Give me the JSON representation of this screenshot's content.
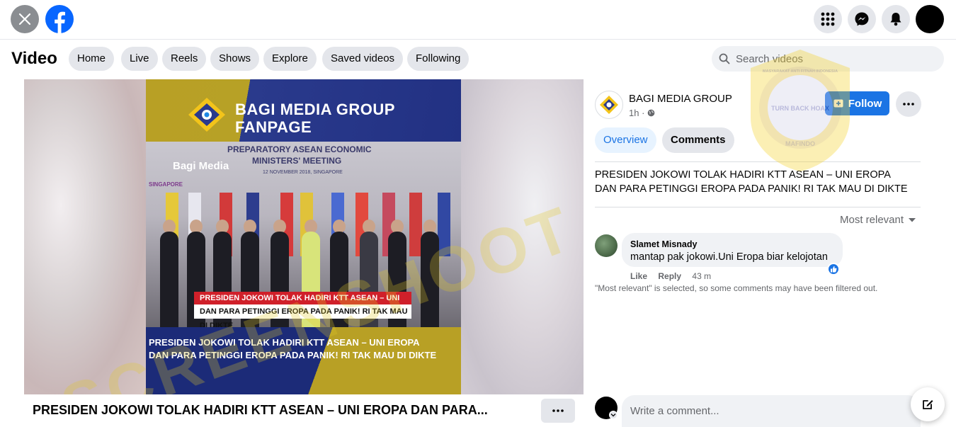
{
  "topbar": {
    "close_icon": "close-icon",
    "logo_icon": "facebook-logo-icon",
    "menu_icon": "grid-menu-icon",
    "messenger_icon": "messenger-icon",
    "notifications_icon": "bell-icon"
  },
  "nav": {
    "title": "Video",
    "tabs": [
      {
        "label": "Home"
      },
      {
        "label": "Live"
      },
      {
        "label": "Reels"
      },
      {
        "label": "Shows"
      },
      {
        "label": "Explore"
      },
      {
        "label": "Saved videos"
      },
      {
        "label": "Following"
      }
    ],
    "search_placeholder": "Search videos"
  },
  "video": {
    "brand_line1": "BAGI MEDIA GROUP",
    "brand_line2": "FANPAGE",
    "banner_line1": "PREPARATORY ASEAN ECONOMIC",
    "banner_line2": "MINISTERS' MEETING",
    "banner_date": "12 NOVEMBER 2018, SINGAPORE",
    "bagi_small": "Bagi Media",
    "singapore": "SINGAPORE",
    "red_band": "PRESIDEN JOKOWI TOLAK HADIRI KTT ASEAN – UNI EROPA",
    "white_band": "DAN PARA PETINGGI EROPA PADA PANIK! RI TAK MAU DI DIKTE",
    "caption_line1": "PRESIDEN JOKOWI TOLAK HADIRI KTT ASEAN – UNI EROPA",
    "caption_line2": "DAN PARA PETINGGI EROPA PADA PANIK! RI TAK MAU DI DIKTE",
    "watermark": "SCREENSHOOT BY",
    "title": "PRESIDEN JOKOWI TOLAK HADIRI KTT ASEAN – UNI EROPA DAN PARA..."
  },
  "post": {
    "page_name": "BAGI MEDIA GROUP",
    "time": "1h ·",
    "follow_label": "Follow",
    "tab_overview": "Overview",
    "tab_comments": "Comments",
    "description": "PRESIDEN JOKOWI TOLAK HADIRI KTT ASEAN – UNI EROPA DAN PARA PETINGGI EROPA PADA PANIK! RI TAK MAU DI DIKTE",
    "sort_label": "Most relevant"
  },
  "comments": [
    {
      "author": "Slamet Misnady",
      "text": "mantap pak jokowi.Uni Eropa biar kelojotan",
      "like": "Like",
      "reply": "Reply",
      "time": "43 m"
    }
  ],
  "filter_note": "\"Most relevant\" is selected, so some comments may have been filtered out.",
  "comment_box": {
    "placeholder": "Write a comment..."
  },
  "stamp": {
    "text": "TURN BACK HOAX",
    "ring_text": "MASYARAKAT ANTI FITNAH INDONESIA",
    "bottom_text": "MAFINDO"
  },
  "colors": {
    "accent": "#1b74e4",
    "watermark": "#e1c828",
    "brand_gold": "#b8a025",
    "brand_navy": "#223183",
    "red_band": "#d0202a"
  }
}
